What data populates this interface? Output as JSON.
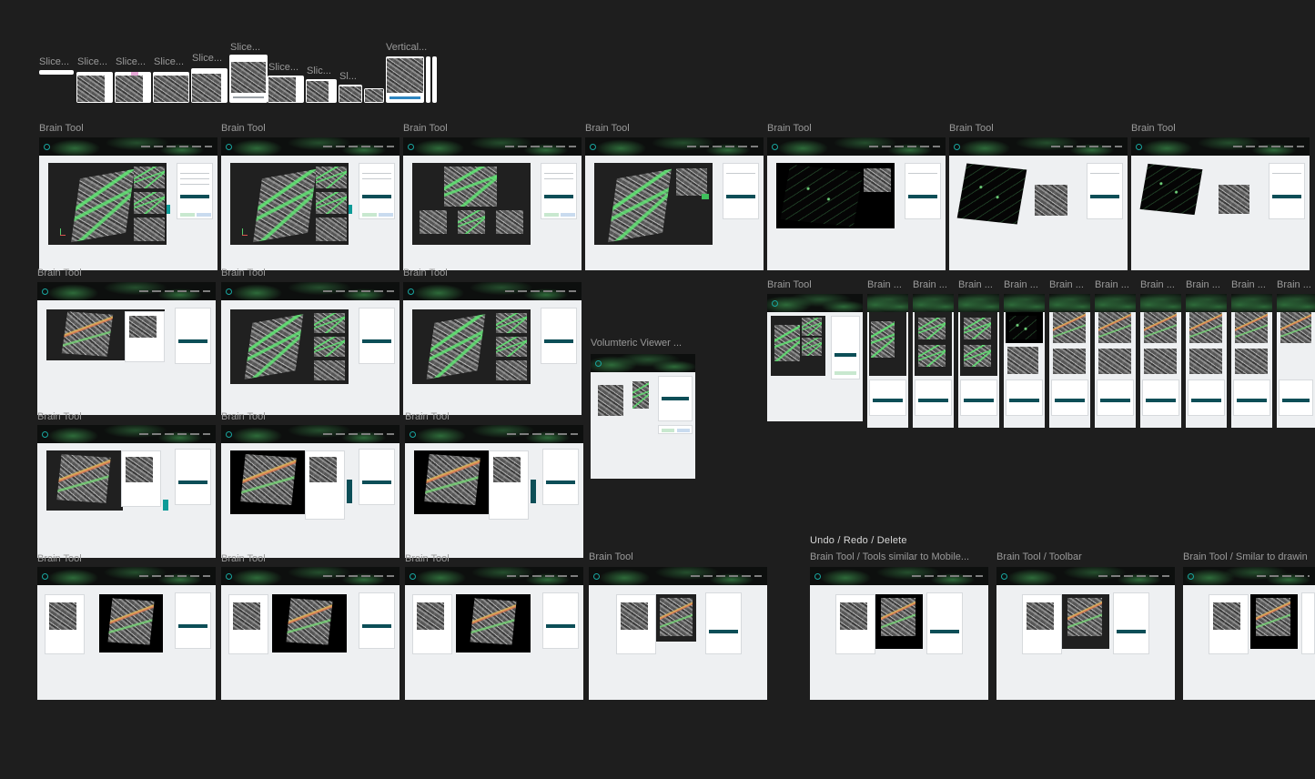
{
  "slice_labels": [
    "Slice...",
    "Slice...",
    "Slice...",
    "Slice...",
    "Slice...",
    "Slice...",
    "Slice...",
    "Slic...",
    "Sl...",
    "Vertical..."
  ],
  "frame_title": "Brain Tool",
  "brain_short": "Brain ...",
  "volumetric_label": "Volumteric Viewer ...",
  "undo_label": "Undo / Redo / Delete",
  "variant_labels": [
    "Brain Tool / Tools similar to Mobile...",
    "Brain Tool / Toolbar",
    "Brain Tool / Smilar to drawin"
  ],
  "colors": {
    "canvas": "#1e1e1e",
    "accent": "#0e9b98",
    "brand_dark": "#0c4e57",
    "overlay_green": "#5feb73"
  }
}
